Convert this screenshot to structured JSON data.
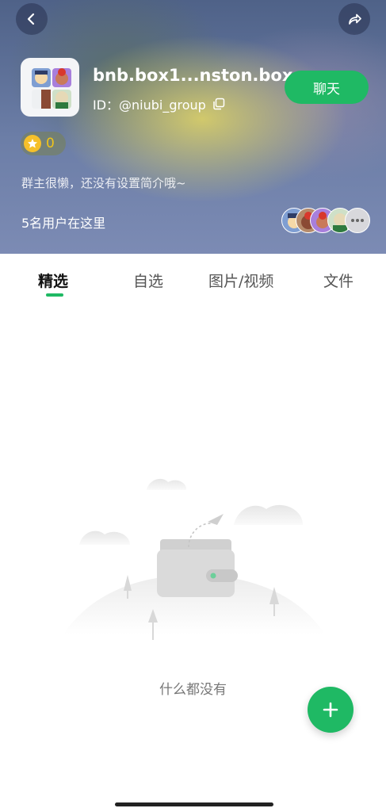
{
  "header": {
    "group_name": "bnb.box1...nston.box",
    "group_id": "ID：@niubi_group",
    "chat_button": "聊天",
    "score": "0",
    "intro": "群主很懒，还没有设置简介哦~",
    "members_label": "5名用户在这里"
  },
  "tabs": [
    {
      "label": "精选",
      "active": true
    },
    {
      "label": "自选",
      "active": false
    },
    {
      "label": "图片/视频",
      "active": false
    },
    {
      "label": "文件",
      "active": false
    }
  ],
  "empty_state": {
    "text": "什么都没有"
  },
  "colors": {
    "accent": "#1fb964",
    "star": "#f5c02a"
  },
  "icons": {
    "back": "chevron-left-icon",
    "share": "share-icon",
    "copy": "copy-icon",
    "star": "star-icon",
    "more": "more-icon",
    "add": "plus-icon"
  }
}
